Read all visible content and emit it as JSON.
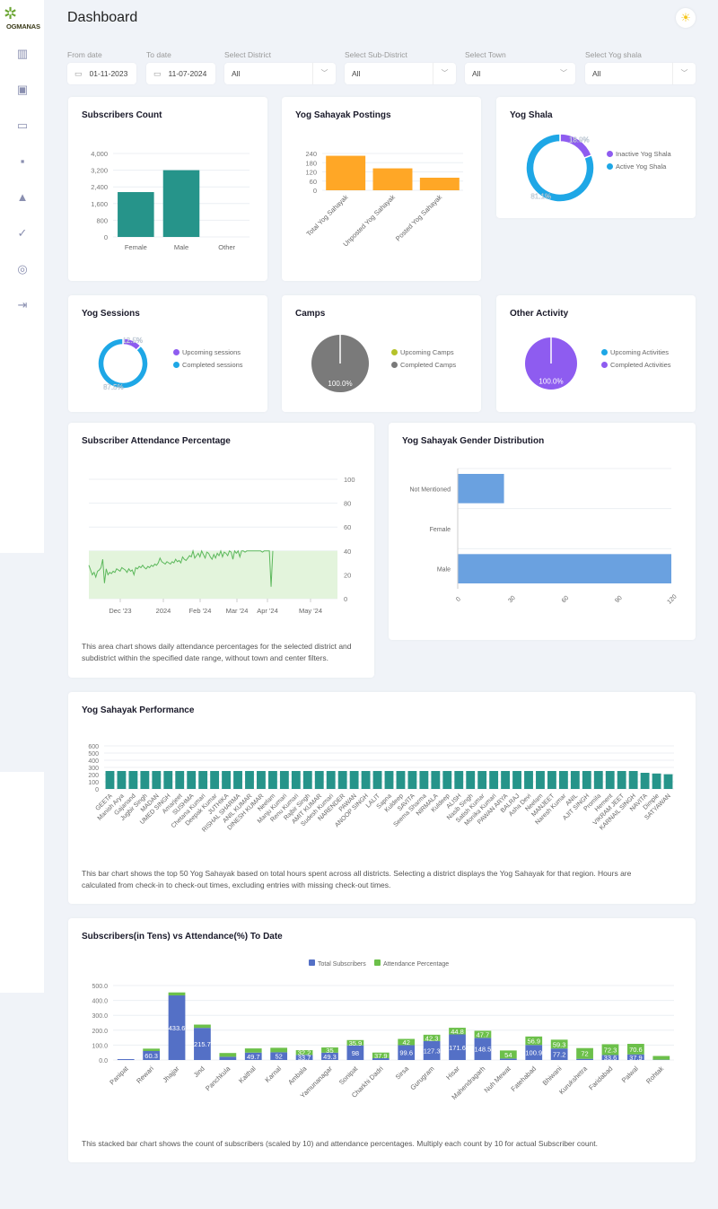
{
  "app": {
    "logo_text": "OGMANAS",
    "page_title": "Dashboard"
  },
  "sidebar": {
    "items": [
      {
        "icon": "bar-chart-icon",
        "glyph": "▥"
      },
      {
        "icon": "settings-doc-icon",
        "glyph": "▣"
      },
      {
        "icon": "card-icon",
        "glyph": "▭"
      },
      {
        "icon": "file-icon",
        "glyph": "▪"
      },
      {
        "icon": "camp-tent-icon",
        "glyph": "▲"
      },
      {
        "icon": "check-badge-icon",
        "glyph": "✓"
      },
      {
        "icon": "fingerprint-icon",
        "glyph": "◎"
      },
      {
        "icon": "logout-icon",
        "glyph": "⇥"
      }
    ]
  },
  "header": {
    "theme_icon": "sun-icon",
    "theme_glyph": "☀"
  },
  "filters": {
    "from_date": {
      "label": "From date",
      "value": "01-11-2023"
    },
    "to_date": {
      "label": "To date",
      "value": "11-07-2024"
    },
    "district": {
      "label": "Select District",
      "value": "All"
    },
    "sub_district": {
      "label": "Select Sub-District",
      "value": "All"
    },
    "town": {
      "label": "Select Town",
      "value": "All"
    },
    "yog_shala": {
      "label": "Select Yog shala",
      "value": "All"
    }
  },
  "cards": {
    "subscribers_count": {
      "title": "Subscribers Count"
    },
    "postings": {
      "title": "Yog Sahayak Postings"
    },
    "yog_shala": {
      "title": "Yog Shala"
    },
    "sessions": {
      "title": "Yog Sessions"
    },
    "camps": {
      "title": "Camps"
    },
    "other_activity": {
      "title": "Other Activity"
    },
    "attendance": {
      "title": "Subscriber Attendance Percentage",
      "description": "This area chart shows daily attendance percentages for the selected district and subdistrict within the specified date range, without town and center filters."
    },
    "gender": {
      "title": "Yog Sahayak Gender Distribution"
    },
    "performance": {
      "title": "Yog Sahayak Performance",
      "description": "This bar chart shows the top 50 Yog Sahayak based on total hours spent across all districts. Selecting a district displays the Yog Sahayak for that region. Hours are calculated from check-in to check-out times, excluding entries with missing check-out times."
    },
    "subs_vs_att": {
      "title": "Subscribers(in Tens) vs Attendance(%) To Date",
      "description": "This stacked bar chart shows the count of subscribers (scaled by 10) and attendance percentages. Multiply each count by 10 for actual Subscriber count."
    }
  },
  "chart_data": [
    {
      "id": "subscribers_count",
      "type": "bar",
      "title": "Subscribers Count",
      "categories": [
        "Female",
        "Male",
        "Other"
      ],
      "values": [
        2150,
        3200,
        0
      ],
      "yticks": [
        "0",
        "800",
        "1,600",
        "2,400",
        "3,200",
        "4,000"
      ],
      "ylim": [
        0,
        4000
      ],
      "color": "#26948a"
    },
    {
      "id": "postings",
      "type": "bar",
      "title": "Yog Sahayak Postings",
      "categories": [
        "Total Yog Sahayak",
        "Unposted Yog Sahayak",
        "Posted Yog Sahayak"
      ],
      "values": [
        225,
        143,
        82
      ],
      "yticks": [
        "0",
        "60",
        "120",
        "180",
        "240"
      ],
      "ylim": [
        0,
        240
      ],
      "color": "#ffa726"
    },
    {
      "id": "yog_shala",
      "type": "pie",
      "donut": true,
      "title": "Yog Shala",
      "labels": [
        "Inactive Yog Shala",
        "Active Yog Shala"
      ],
      "values": [
        18.9,
        81.1
      ],
      "value_labels": [
        "18.9%",
        "81.1%"
      ],
      "colors": [
        "#8e5cf0",
        "#1ea7e6"
      ]
    },
    {
      "id": "sessions",
      "type": "pie",
      "donut": true,
      "title": "Yog Sessions",
      "labels": [
        "Upcoming sessions",
        "Completed sessions"
      ],
      "values": [
        12.5,
        87.5
      ],
      "value_labels": [
        "12.5%",
        "87.5%"
      ],
      "colors": [
        "#8e5cf0",
        "#1ea7e6"
      ]
    },
    {
      "id": "camps",
      "type": "pie",
      "title": "Camps",
      "labels": [
        "Upcoming Camps",
        "Completed Camps"
      ],
      "values": [
        0,
        100
      ],
      "value_labels": [
        "",
        "100.0%"
      ],
      "colors": [
        "#b5c22a",
        "#7a7a7a"
      ]
    },
    {
      "id": "other_activity",
      "type": "pie",
      "title": "Other Activity",
      "labels": [
        "Upcoming Activities",
        "Completed Activities"
      ],
      "values": [
        0,
        100
      ],
      "value_labels": [
        "",
        "100.0%"
      ],
      "colors": [
        "#1ea7e6",
        "#8e5cf0"
      ]
    },
    {
      "id": "attendance",
      "type": "area",
      "title": "Subscriber Attendance Percentage",
      "xticks": [
        "Dec '23",
        "2024",
        "Feb '24",
        "Mar '24",
        "Apr '24",
        "May '24"
      ],
      "yticks": [
        "0",
        "20",
        "40",
        "60",
        "80",
        "100"
      ],
      "ylim": [
        0,
        100
      ],
      "y": [
        28,
        24,
        20,
        22,
        18,
        23,
        24,
        26,
        33,
        13,
        25,
        20,
        22,
        21,
        23,
        22,
        25,
        24,
        23,
        26,
        25,
        24,
        22,
        25,
        23,
        24,
        20,
        26,
        25,
        27,
        26,
        28,
        26,
        25,
        27,
        26,
        28,
        27,
        29,
        28,
        30,
        34,
        31,
        30,
        29,
        31,
        30,
        29,
        31,
        30,
        33,
        31,
        32,
        30,
        35,
        33,
        32,
        34,
        36,
        35,
        40,
        34,
        36,
        38,
        35,
        40,
        37,
        34,
        39,
        38,
        35,
        33,
        37,
        34,
        38,
        36,
        40,
        35,
        39,
        38,
        36,
        40,
        39,
        33,
        40,
        38,
        40,
        35,
        40,
        40,
        39,
        40,
        40,
        40,
        40,
        40,
        40,
        40,
        40,
        40,
        39,
        40,
        40,
        40,
        40,
        10,
        40
      ],
      "series_end_fraction": 0.74,
      "color": "#5cb85c"
    },
    {
      "id": "gender",
      "type": "bar",
      "orientation": "horizontal",
      "title": "Yog Sahayak Gender Distribution",
      "categories": [
        "Not Mentioned",
        "Female",
        "Male"
      ],
      "values": [
        26,
        0,
        120
      ],
      "xticks": [
        "0",
        "30",
        "60",
        "90",
        "120"
      ],
      "xlim": [
        0,
        120
      ],
      "color": "#6aa1e0"
    },
    {
      "id": "performance",
      "type": "bar",
      "title": "Yog Sahayak Performance",
      "categories": [
        "GEETA",
        "Manish Arya",
        "Gajanand",
        "Jugbir Singh",
        "MADAN",
        "UMED SINGH",
        "Amarjeet",
        "SUSHMA",
        "Chetana Kumari",
        "Deepak Kumar",
        "JUTHIKA",
        "RISHAL SHARMA",
        "ANIL KUMAR",
        "DINESH KUMAR",
        "Neelam",
        "Manju Kumari",
        "Renu Kumari",
        "Rajbir Singh",
        "AMIT KUMAR",
        "Sudesh Kumari",
        "NARENDER",
        "PAWAN",
        "ANOOP SINGH",
        "LALIT",
        "Sapna",
        "Kuldeep",
        "SAVITA",
        "Seema Sharma",
        "NIRMALA",
        "Kuldeep",
        "ALISH",
        "Nasib Singh",
        "Satish Kumar",
        "Monika Kumari",
        "PAWAN ARYA",
        "BALRAJ",
        "Asha Devi",
        "Neelam",
        "MANJEET",
        "Naresh Kumar",
        "ANIL",
        "AJIT SINGH",
        "Promila",
        "Hement",
        "VIKRAM JEET",
        "KARNAIL SINGH",
        "NAVITA",
        "Dimple",
        "SATYAWAN"
      ],
      "values": [
        250,
        250,
        250,
        250,
        250,
        250,
        250,
        250,
        250,
        250,
        250,
        250,
        250,
        250,
        250,
        250,
        250,
        250,
        250,
        250,
        250,
        250,
        250,
        250,
        250,
        250,
        250,
        250,
        250,
        250,
        250,
        250,
        250,
        250,
        250,
        250,
        250,
        250,
        250,
        250,
        250,
        250,
        250,
        250,
        250,
        250,
        225,
        215,
        205
      ],
      "yticks": [
        "0",
        "100",
        "200",
        "300",
        "400",
        "500",
        "600"
      ],
      "ylim": [
        0,
        600
      ],
      "color": "#26948a"
    },
    {
      "id": "subs_vs_att",
      "type": "bar",
      "stacked": true,
      "title": "Subscribers(in Tens) vs Attendance(%) To Date",
      "categories": [
        "Panipat",
        "Rewari",
        "Jhajjar",
        "Jind",
        "Panchkula",
        "Kaithal",
        "Karnal",
        "Ambala",
        "Yamunanagar",
        "Sonipat",
        "Charkhi Dadri",
        "Sirsa",
        "Gurugram",
        "Hisar",
        "Mahendragarh",
        "Nuh Mewat",
        "Fatehabad",
        "Bhiwani",
        "Kurukshetra",
        "Faridabad",
        "Palwal",
        "Rohtak"
      ],
      "series": [
        {
          "name": "Total Subscribers",
          "color": "#5470c6",
          "values": [
            6,
            60.3,
            433.6,
            215.7,
            22,
            49.7,
            52,
            33.7,
            49.3,
            98,
            12,
            99.6,
            127.3,
            171.6,
            148.5,
            10,
            100.9,
            77.2,
            8,
            33.6,
            37.9,
            2
          ],
          "labels": [
            "",
            "60.3",
            "433.6",
            "215.7",
            "",
            "49.7",
            "52",
            "33.7",
            "49.3",
            "98",
            "",
            "99.6",
            "127.3",
            "171.6",
            "148.5",
            "",
            "100.9",
            "77.2",
            "",
            "33.6",
            "37.9",
            ""
          ]
        },
        {
          "name": "Attendance Percentage",
          "color": "#6cc04a",
          "values": [
            0,
            16,
            20,
            22,
            25,
            28,
            30,
            32.2,
            35,
            35.9,
            37.9,
            42,
            42.3,
            44.8,
            47.7,
            54,
            56.9,
            59.3,
            72,
            72.3,
            70.6,
            25
          ],
          "labels": [
            "",
            "",
            "",
            "",
            "",
            "",
            "",
            "32.2",
            "35",
            "35.9",
            "37.9",
            "42",
            "42.3",
            "44.8",
            "47.7",
            "54",
            "56.9",
            "59.3",
            "72",
            "72.3",
            "70.6",
            ""
          ]
        }
      ],
      "yticks": [
        "0.0",
        "100.0",
        "200.0",
        "300.0",
        "400.0",
        "500.0"
      ],
      "ylim": [
        0,
        500
      ]
    }
  ]
}
